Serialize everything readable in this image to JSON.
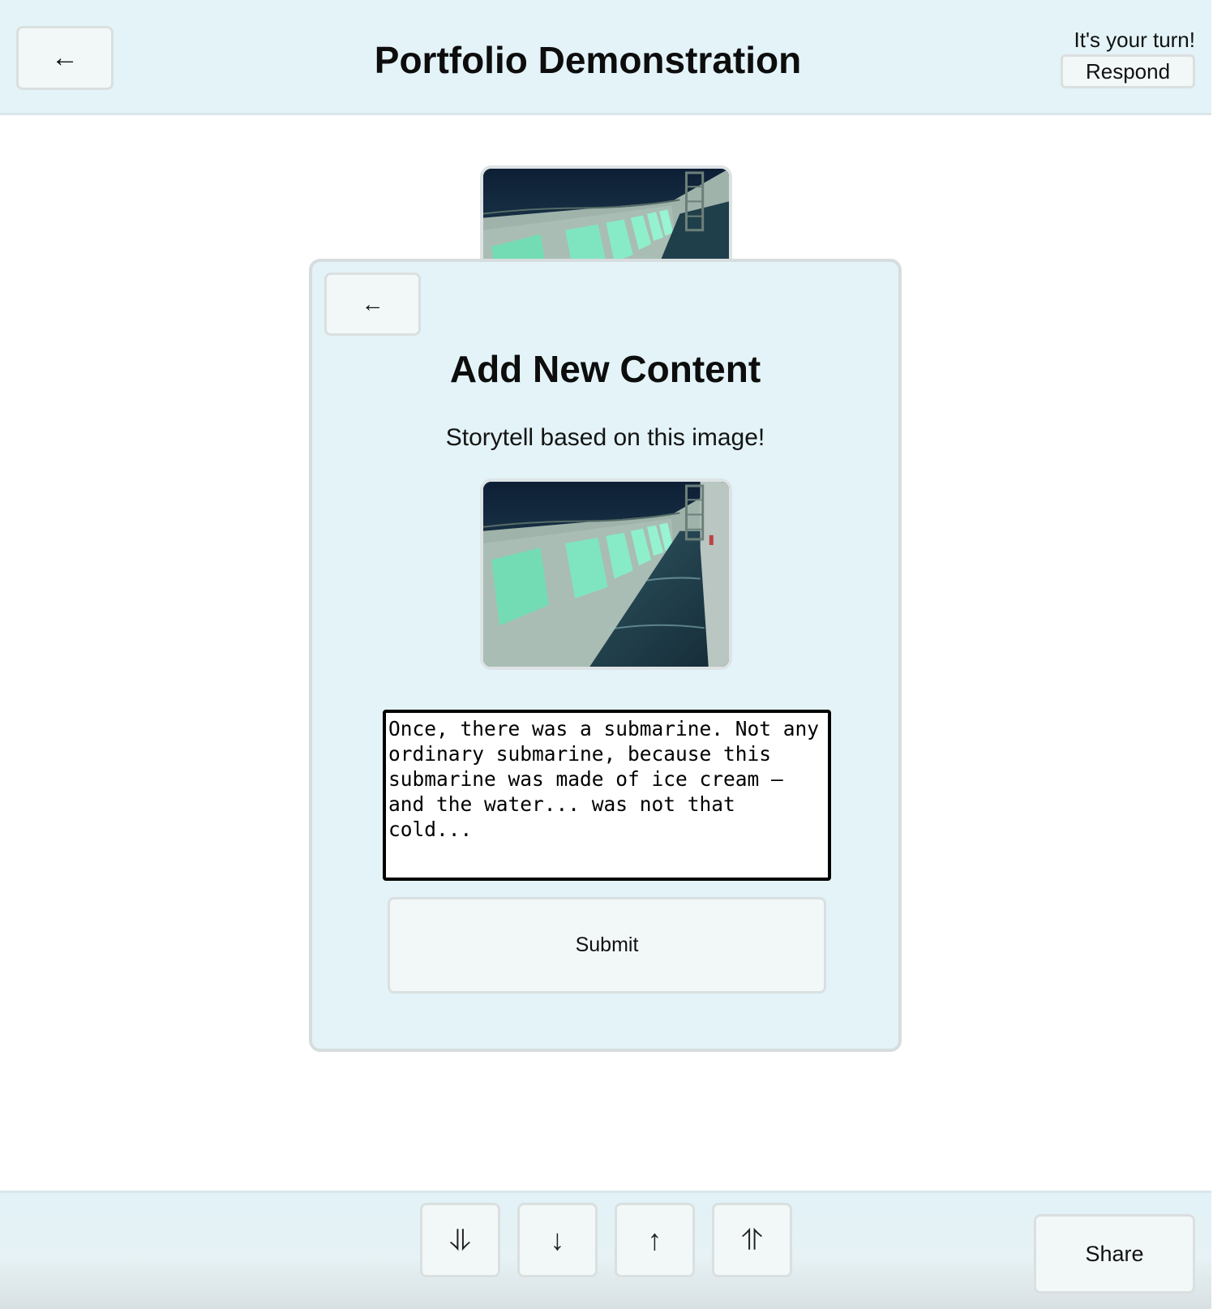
{
  "header": {
    "back_icon": "←",
    "title": "Portfolio Demonstration",
    "turn_text": "It's your turn!",
    "respond_label": "Respond"
  },
  "modal": {
    "back_icon": "←",
    "title": "Add New Content",
    "prompt": "Storytell based on this image!",
    "story_text": "Once, there was a submarine. Not any ordinary submarine, because this submarine was made of ice cream – and the water... was not that cold...",
    "submit_label": "Submit"
  },
  "toolbar": {
    "first_icon": "⥥",
    "down_icon": "↓",
    "up_icon": "↑",
    "last_icon": "⥣",
    "share_label": "Share"
  },
  "colors": {
    "bar_background": "#e3f3f7",
    "button_background": "#f2f8f8",
    "border": "#dadfe0"
  }
}
